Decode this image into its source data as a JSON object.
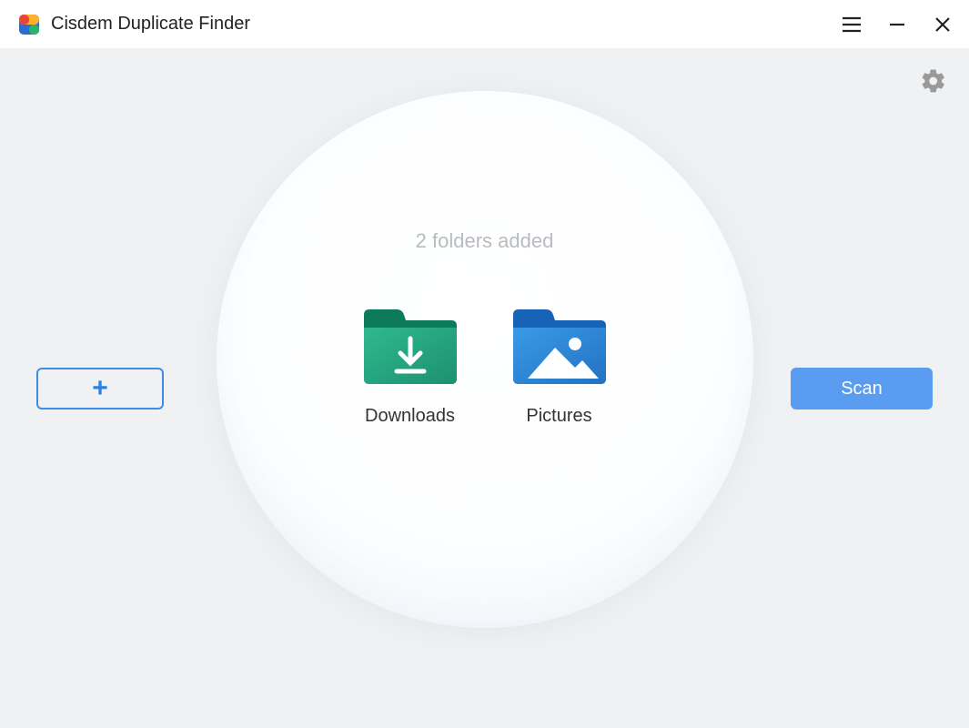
{
  "titlebar": {
    "app_name": "Cisdem Duplicate Finder"
  },
  "main": {
    "status_text": "2 folders added",
    "folders": [
      {
        "name": "Downloads",
        "icon": "downloads-folder-icon"
      },
      {
        "name": "Pictures",
        "icon": "pictures-folder-icon"
      }
    ],
    "add_button_label": "+",
    "scan_button_label": "Scan"
  },
  "icons": {
    "app_logo": "app-logo-icon",
    "hamburger": "menu-icon",
    "minimize": "minimize-icon",
    "close": "close-icon",
    "settings": "gear-icon"
  },
  "colors": {
    "accent_blue": "#5a9cef",
    "outline_blue": "#3d8de6",
    "bg_grey": "#f0f1f3",
    "text_muted": "#b8bbbf"
  }
}
